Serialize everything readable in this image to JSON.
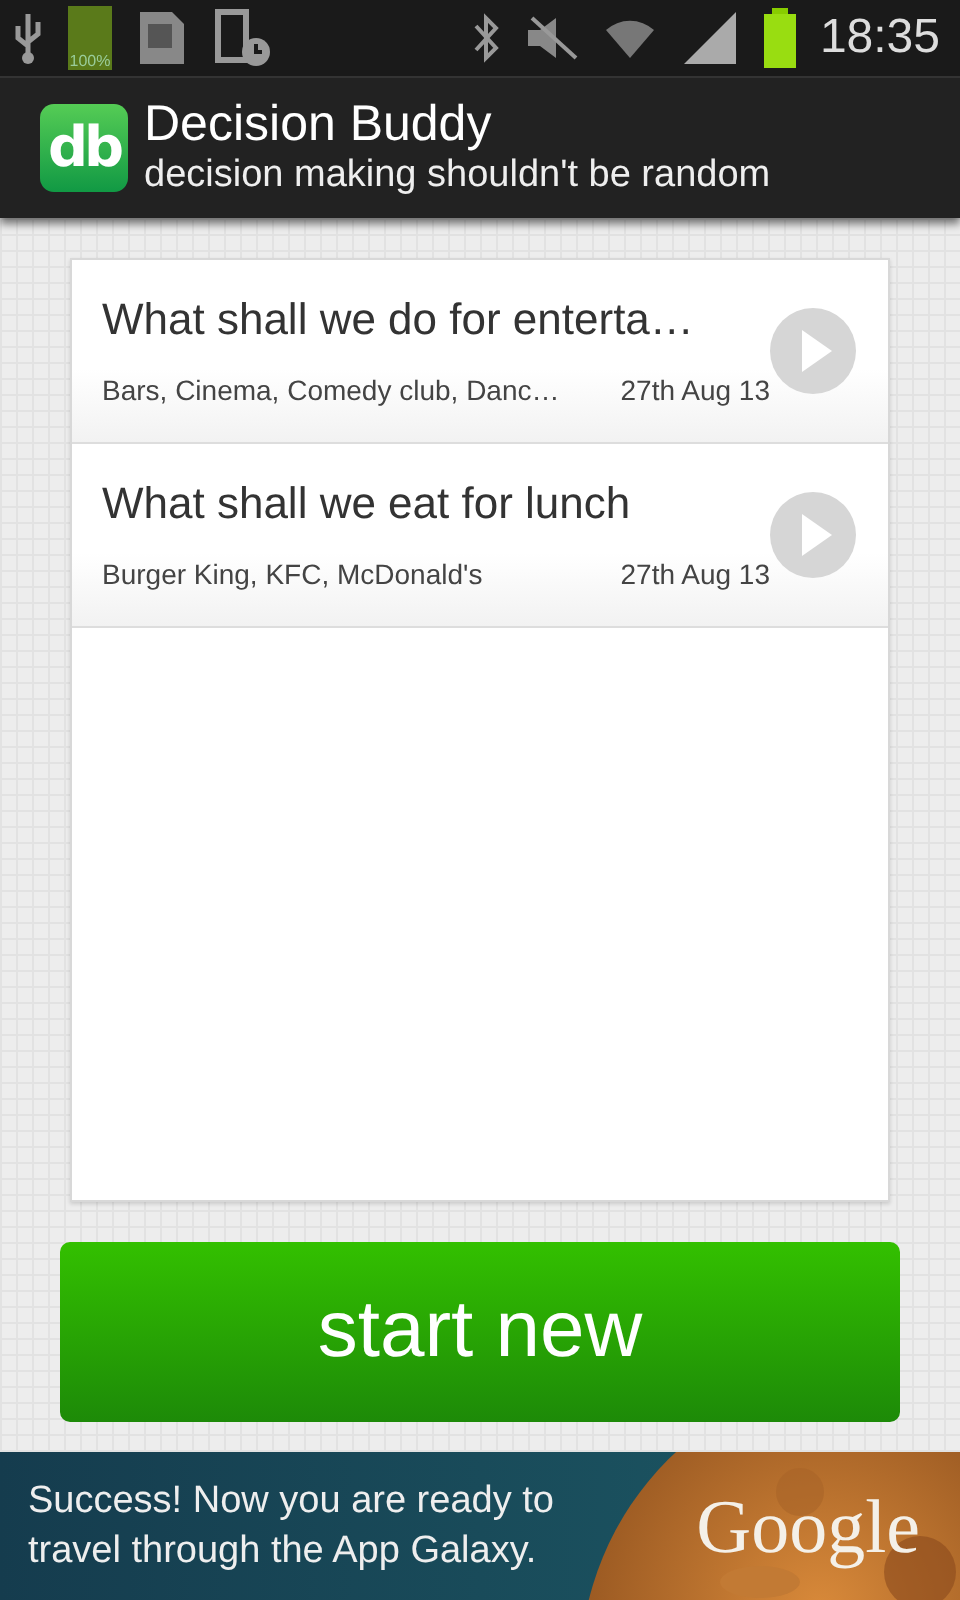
{
  "status_bar": {
    "battery_label": "100%",
    "time": "18:35"
  },
  "app_bar": {
    "title": "Decision Buddy",
    "subtitle": "decision making shouldn't be random",
    "logo": "db"
  },
  "decisions": [
    {
      "title": "What shall we do for enterta…",
      "options": "Bars, Cinema, Comedy club, Danc…",
      "date": "27th Aug 13"
    },
    {
      "title": "What shall we eat for lunch",
      "options": "Burger King, KFC, McDonald's",
      "date": "27th Aug 13"
    }
  ],
  "start_button": {
    "label": "start new"
  },
  "ad_banner": {
    "kind": "picture",
    "message": "Success! Now you are ready to travel through the App Galaxy.",
    "brand": "Google"
  }
}
